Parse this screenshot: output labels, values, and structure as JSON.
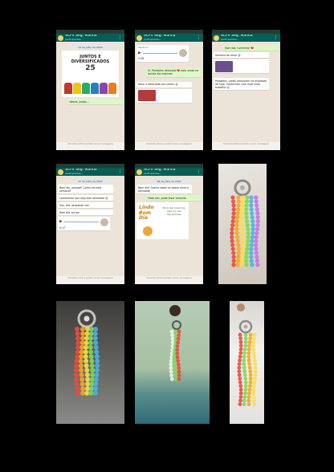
{
  "chat": {
    "name": "SCFV Seg. Manhã",
    "subtitle": "participantes...",
    "footer": "Somente admins podem enviar mensagens"
  },
  "screens": {
    "s1": {
      "date": "24 de julho de 2020",
      "poster_title": "JUNTOS E DIVERSIFICADOS",
      "poster_number": "25",
      "caption": "Vamos juntos..."
    },
    "s2": {
      "sender": "Telefone",
      "message": "Ei, Parabéns dedicada ❤️ pelo vinda na quinta dia meninos",
      "reply": "Amei a dedicação da turma! 😊",
      "voice_time": "0:28"
    },
    "s3": {
      "message1": "Bom dia, turminha! ❤️",
      "message2": "Semana de amor 😊",
      "message3": "Parabéns, vocês arrasaram na atividade de hoje. Continuem com esse lindo trabalho 😊"
    },
    "s4": {
      "date": "27 de julho de 2020",
      "message1": "Bom dia, pessoal! Como vai esta semana?",
      "message2": "Lembrando que hoje tem atividade 😊",
      "message3": "Sim, tem atividade sim",
      "message4": "Bom dia, turma",
      "voice_time": "0:17"
    },
    "s5": {
      "date": "28 de julho de 2020",
      "message1": "Bom dia! Queria saber se posso levar a atividade",
      "message2": "Pode sim, pode levar amanhã",
      "greeting_text": "Lindo Bom Dia",
      "greeting_side": "Bom dia! Que hoje seja um dia maravilhoso"
    }
  },
  "photos": [
    {
      "name": "keychain-photo-1",
      "colors": [
        "#e84c3d",
        "#f5a623",
        "#f7e04b",
        "#7ed957",
        "#4ab3e8",
        "#c873e8"
      ]
    },
    {
      "name": "keychain-photo-2",
      "colors": [
        "#e84c3d",
        "#f5a623",
        "#f7e04b",
        "#7ed957",
        "#4ab3e8"
      ]
    },
    {
      "name": "keychain-photo-3",
      "colors": [
        "#f2f2f2",
        "#7ed957",
        "#e84c3d"
      ]
    },
    {
      "name": "keychain-photo-4",
      "colors": [
        "#e84c3d",
        "#7ed957",
        "#f5a623",
        "#f7e04b"
      ]
    }
  ]
}
